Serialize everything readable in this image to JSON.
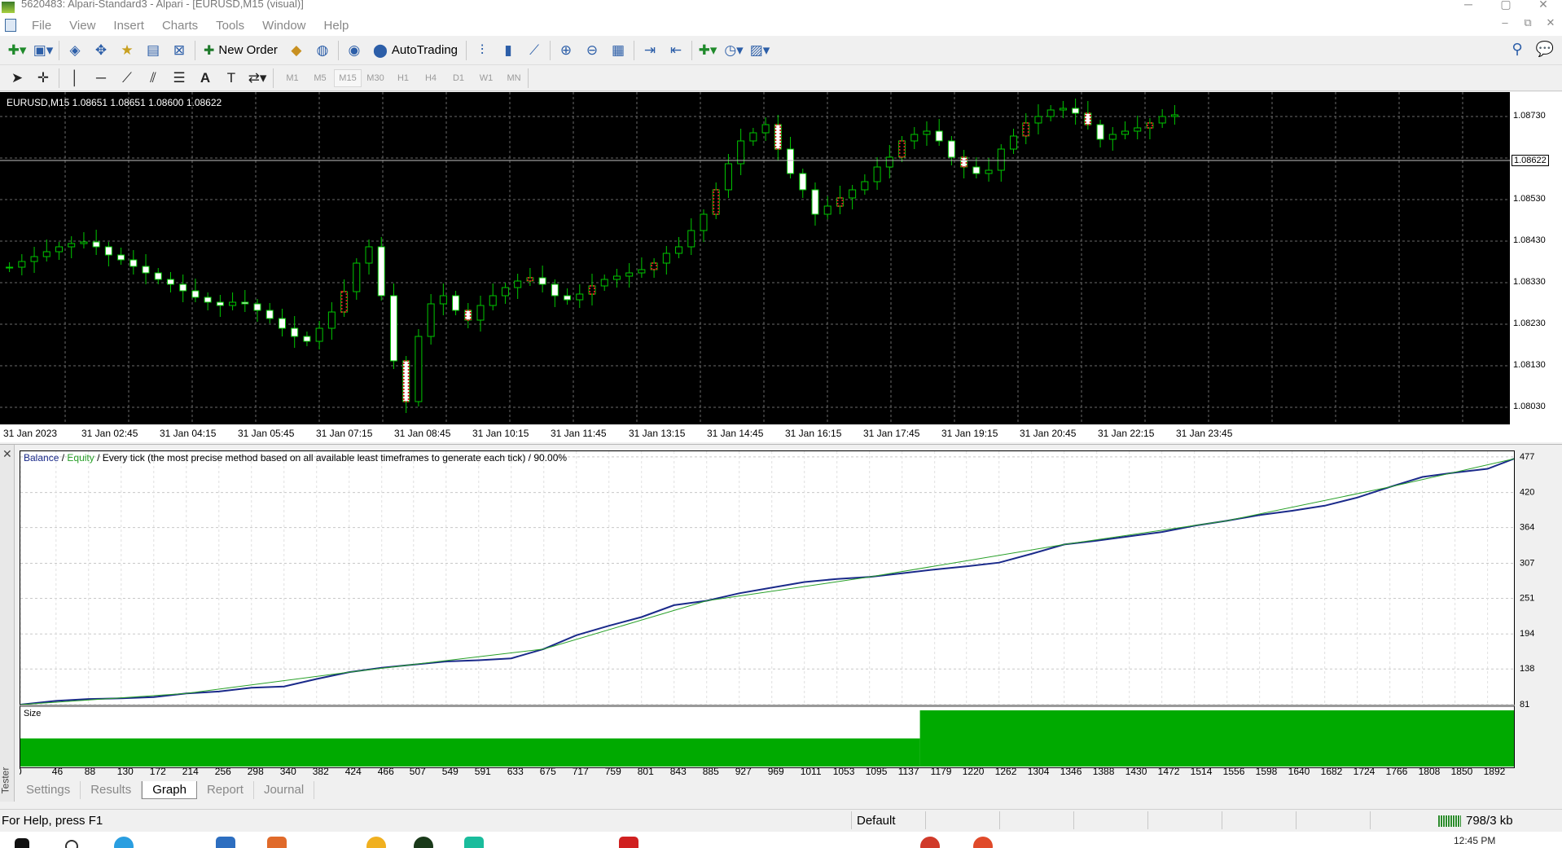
{
  "window": {
    "title": "5620483: Alpari-Standard3 - Alpari - [EURUSD,M15 (visual)]",
    "controls": [
      "─",
      "▢",
      "✕"
    ]
  },
  "menu": {
    "items": [
      "File",
      "View",
      "Insert",
      "Charts",
      "Tools",
      "Window",
      "Help"
    ]
  },
  "toolbar": {
    "new_order": "New Order",
    "autotrading": "AutoTrading"
  },
  "timeframes": [
    "M1",
    "M5",
    "M15",
    "M30",
    "H1",
    "H4",
    "D1",
    "W1",
    "MN"
  ],
  "active_timeframe": "M15",
  "chart": {
    "symbol_line": "EURUSD,M15  1.08651  1.08651  1.08600  1.08622",
    "current_price": "1.08622",
    "price_labels": [
      "1.08730",
      "1.08530",
      "1.08430",
      "1.08330",
      "1.08230",
      "1.08130",
      "1.08030"
    ],
    "time_labels": [
      "31 Jan 2023",
      "31 Jan 02:45",
      "31 Jan 04:15",
      "31 Jan 05:45",
      "31 Jan 07:15",
      "31 Jan 08:45",
      "31 Jan 10:15",
      "31 Jan 11:45",
      "31 Jan 13:15",
      "31 Jan 14:45",
      "31 Jan 16:15",
      "31 Jan 17:45",
      "31 Jan 19:15",
      "31 Jan 20:45",
      "31 Jan 22:15",
      "31 Jan 23:45"
    ],
    "background": "#000000",
    "grid_color": "#6a6a6a"
  },
  "tester": {
    "side_label": "Tester",
    "legend": {
      "balance": "Balance",
      "sep": " / ",
      "equity": "Equity",
      "rest": " / Every tick (the most precise method based on all available least timeframes to generate each tick) / 90.00%"
    },
    "size_label": "Size",
    "tabs": [
      "Settings",
      "Results",
      "Graph",
      "Report",
      "Journal"
    ],
    "active_tab": "Graph"
  },
  "chart_data": [
    {
      "type": "line",
      "title": "",
      "series": [
        {
          "name": "Balance",
          "color": "#1a2a8a",
          "x": [
            0,
            46,
            88,
            130,
            172,
            214,
            256,
            298,
            340,
            382,
            424,
            466,
            507,
            549,
            591,
            633,
            675,
            717,
            759,
            801,
            843,
            885,
            927,
            969,
            1011,
            1053,
            1095,
            1137,
            1179,
            1220,
            1262,
            1304,
            1346,
            1388,
            1430,
            1472,
            1514,
            1556,
            1598,
            1640,
            1682,
            1724,
            1766,
            1808,
            1850,
            1892,
            1926
          ],
          "values": [
            81,
            87,
            90,
            91,
            93,
            99,
            102,
            108,
            110,
            122,
            133,
            140,
            145,
            150,
            152,
            155,
            170,
            192,
            207,
            221,
            240,
            247,
            259,
            268,
            277,
            282,
            285,
            291,
            297,
            302,
            308,
            322,
            337,
            343,
            350,
            357,
            367,
            375,
            384,
            391,
            399,
            412,
            429,
            445,
            452,
            458,
            474
          ]
        },
        {
          "name": "Equity",
          "color": "#28a028",
          "x": [
            0,
            214,
            424,
            675,
            885,
            1095,
            1346,
            1556,
            1766,
            1926
          ],
          "values": [
            81,
            99,
            133,
            170,
            247,
            285,
            337,
            375,
            429,
            474
          ]
        }
      ],
      "yticks": [
        477,
        420,
        364,
        307,
        251,
        194,
        138,
        81
      ],
      "xticks": [
        0,
        46,
        88,
        130,
        172,
        214,
        256,
        298,
        340,
        382,
        424,
        466,
        507,
        549,
        591,
        633,
        675,
        717,
        759,
        801,
        843,
        885,
        927,
        969,
        1011,
        1053,
        1095,
        1137,
        1179,
        1220,
        1262,
        1304,
        1346,
        1388,
        1430,
        1472,
        1514,
        1556,
        1598,
        1640,
        1682,
        1724,
        1766,
        1808,
        1850,
        1892
      ],
      "ylim": [
        81,
        486
      ],
      "xlim": [
        0,
        1926
      ],
      "grid": true
    },
    {
      "type": "area",
      "title": "Size",
      "series": [
        {
          "name": "Size",
          "color": "#00aa00",
          "x": [
            0,
            1160,
            1160,
            1926
          ],
          "values": [
            0.01,
            0.01,
            0.02,
            0.02
          ]
        }
      ],
      "ylim": [
        0,
        0.02
      ]
    }
  ],
  "status": {
    "help": "For Help, press F1",
    "profile": "Default",
    "traffic": "798/3 kb",
    "clock": "12:45 PM"
  }
}
